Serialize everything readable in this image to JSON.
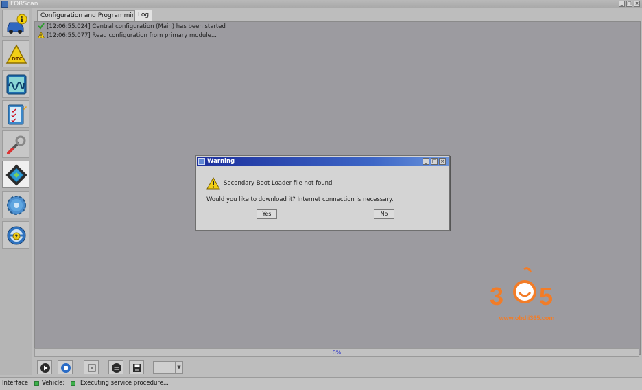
{
  "window": {
    "title": "FORScan"
  },
  "tabs": [
    {
      "label": "Configuration and Programming"
    },
    {
      "label": "Log"
    }
  ],
  "log": [
    {
      "status": "success",
      "icon": "check-icon",
      "text": "[12:06:55.024] Central configuration (Main) has been started"
    },
    {
      "status": "warning",
      "icon": "warning-icon",
      "text": "[12:06:55.077] Read configuration from primary module..."
    }
  ],
  "dialog": {
    "title": "Warning",
    "message": "Secondary Boot Loader file not found",
    "question": "Would you like to download it? Internet connection is necessary.",
    "yes_label": "Yes",
    "no_label": "No"
  },
  "progress": {
    "label": "0%",
    "value": 0
  },
  "toolbar": {
    "select_value": ""
  },
  "status": {
    "interface_label": "Interface:",
    "vehicle_label": "Vehicle:",
    "message": "Executing service procedure..."
  },
  "watermark": {
    "digits": [
      "3",
      "6",
      "5"
    ],
    "url": "www.obdii365.com"
  },
  "colors": {
    "dialog_title": "#1c2f9c",
    "led_green": "#3cb04a",
    "progress_text": "#3138c9",
    "watermark": "#f27c27"
  }
}
